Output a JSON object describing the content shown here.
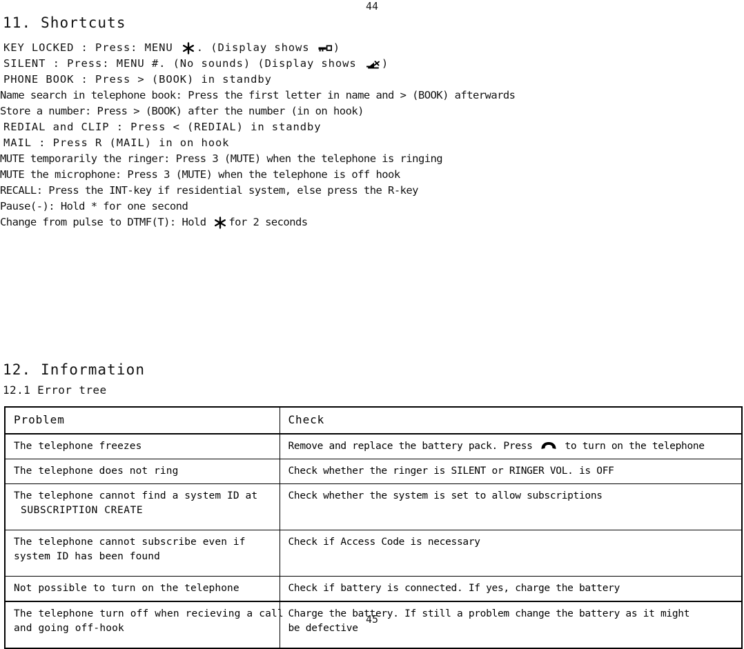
{
  "page": {
    "number_top": "44",
    "number_bottom": "45"
  },
  "sections": {
    "shortcuts": {
      "heading": "11. Shortcuts",
      "lines": [
        {
          "id": "key-locked",
          "parts": [
            {
              "type": "text",
              "value": "KEY LOCKED : Press: MENU "
            },
            {
              "type": "icon",
              "value": "star-icon"
            },
            {
              "type": "text",
              "value": ". (Display shows "
            },
            {
              "type": "icon",
              "value": "key-icon"
            },
            {
              "type": "text",
              "value": ")"
            }
          ],
          "plain": "KEY LOCKED : Press: MENU *. (Display shows [key])"
        },
        {
          "id": "silent",
          "parts": [
            {
              "type": "text",
              "value": "SILENT : Press: MENU #. (No sounds) (Display shows "
            },
            {
              "type": "icon",
              "value": "mute-icon"
            },
            {
              "type": "text",
              "value": ")"
            }
          ],
          "plain": "SILENT : Press: MENU #. (No sounds) (Display shows [mute])"
        },
        {
          "id": "phone-book",
          "plain": "PHONE BOOK : Press > (BOOK) in standby"
        },
        {
          "id": "name-search",
          "plain": "Name search in telephone book: Press the first letter in name and > (BOOK) afterwards"
        },
        {
          "id": "store-number",
          "plain": "Store a number: Press > (BOOK) after the number (in on hook)"
        },
        {
          "id": "redial-clip",
          "plain": "REDIAL  and  CLIP : Press < (REDIAL) in standby"
        },
        {
          "id": "mail",
          "plain": "MAIL : Press R (MAIL) in on hook"
        },
        {
          "id": "mute-ringer",
          "plain": "MUTE temporarily the ringer: Press 3 (MUTE) when the telephone is ringing"
        },
        {
          "id": "mute-microphone",
          "plain": "MUTE the microphone: Press 3 (MUTE) when the telephone is off hook"
        },
        {
          "id": "recall",
          "plain": "RECALL: Press the INT-key if residential system, else press the R-key"
        },
        {
          "id": "pause",
          "plain": "Pause(-): Hold * for one second"
        },
        {
          "id": "pulse-to-dtmf",
          "parts": [
            {
              "type": "text",
              "value": "Change from pulse to DTMF(T): Hold "
            },
            {
              "type": "icon",
              "value": "star-icon"
            },
            {
              "type": "text",
              "value": "for 2 seconds"
            }
          ],
          "plain": "Change from pulse to DTMF(T): Hold * for 2 seconds"
        }
      ]
    },
    "information": {
      "heading": "12. Information",
      "subheading": "12.1 Error tree",
      "error_table": {
        "columns": [
          "Problem",
          "Check"
        ],
        "rows": [
          {
            "problem": [
              "The telephone freezes"
            ],
            "check": {
              "parts": [
                {
                  "type": "text",
                  "value": "Remove and replace the battery pack. Press "
                },
                {
                  "type": "icon",
                  "value": "handset-icon"
                },
                {
                  "type": "text",
                  "value": " to turn on the telephone"
                }
              ],
              "plain": "Remove and replace the battery pack. Press [handset] to turn on the telephone"
            }
          },
          {
            "problem": [
              "The telephone does not ring"
            ],
            "check": {
              "plain": "Check whether the ringer is SILENT or RINGER VOL. is OFF"
            }
          },
          {
            "problem": [
              "The telephone cannot find a system ID at",
              " SUBSCRIPTION CREATE"
            ],
            "check": {
              "plain": "Check whether the system is set to allow subscriptions"
            }
          },
          {
            "problem": [
              "The telephone cannot subscribe even if",
              "system ID has been found"
            ],
            "check": {
              "plain": "Check if Access Code is necessary"
            }
          },
          {
            "problem": [
              "Not possible to turn on the telephone"
            ],
            "check": {
              "plain": "Check if battery is connected. If yes, charge the battery"
            }
          },
          {
            "problem": [
              "The telephone turn off when recieving a call",
              "and going off-hook"
            ],
            "check": {
              "plain": "Charge the battery. If still a problem change the battery as it might",
              "plain2": "be defective"
            }
          }
        ]
      }
    }
  },
  "colors": {
    "text": "#111111",
    "rule": "#000000",
    "background": "#ffffff"
  }
}
